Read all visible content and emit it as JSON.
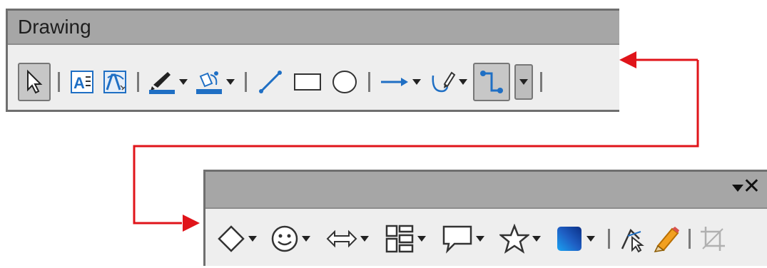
{
  "drawing_toolbar": {
    "title": "Drawing",
    "items": [
      {
        "icon": "select-pointer-icon",
        "pressed": true
      },
      {
        "icon": "text-box-icon"
      },
      {
        "icon": "fontwork-icon"
      },
      {
        "icon": "line-color-icon",
        "dropdown": true
      },
      {
        "icon": "fill-color-icon",
        "dropdown": true
      },
      {
        "icon": "line-icon"
      },
      {
        "icon": "rectangle-icon"
      },
      {
        "icon": "ellipse-icon"
      },
      {
        "icon": "arrow-line-icon",
        "dropdown": true
      },
      {
        "icon": "curve-polygon-icon",
        "dropdown": true
      },
      {
        "icon": "connector-icon",
        "pressed": true,
        "split_dropdown": true
      }
    ]
  },
  "shapes_toolbar": {
    "title": "",
    "menu_icon": "toolbar-menu-icon",
    "close_label": "✕",
    "items": [
      {
        "icon": "basic-shapes-diamond-icon",
        "dropdown": true
      },
      {
        "icon": "symbol-shapes-smiley-icon",
        "dropdown": true
      },
      {
        "icon": "block-arrows-icon",
        "dropdown": true
      },
      {
        "icon": "flowchart-icon",
        "dropdown": true
      },
      {
        "icon": "callouts-icon",
        "dropdown": true
      },
      {
        "icon": "stars-icon",
        "dropdown": true
      },
      {
        "icon": "3d-objects-icon",
        "dropdown": true
      },
      {
        "icon": "points-edit-icon"
      },
      {
        "icon": "glue-points-icon"
      },
      {
        "icon": "crop-icon",
        "disabled": true
      }
    ]
  },
  "colors": {
    "icon_blue": "#1f6fc4",
    "connector_arrow": "#e0141a",
    "titlebar": "#a6a6a6",
    "toolbar_bg": "#eeeeee"
  }
}
